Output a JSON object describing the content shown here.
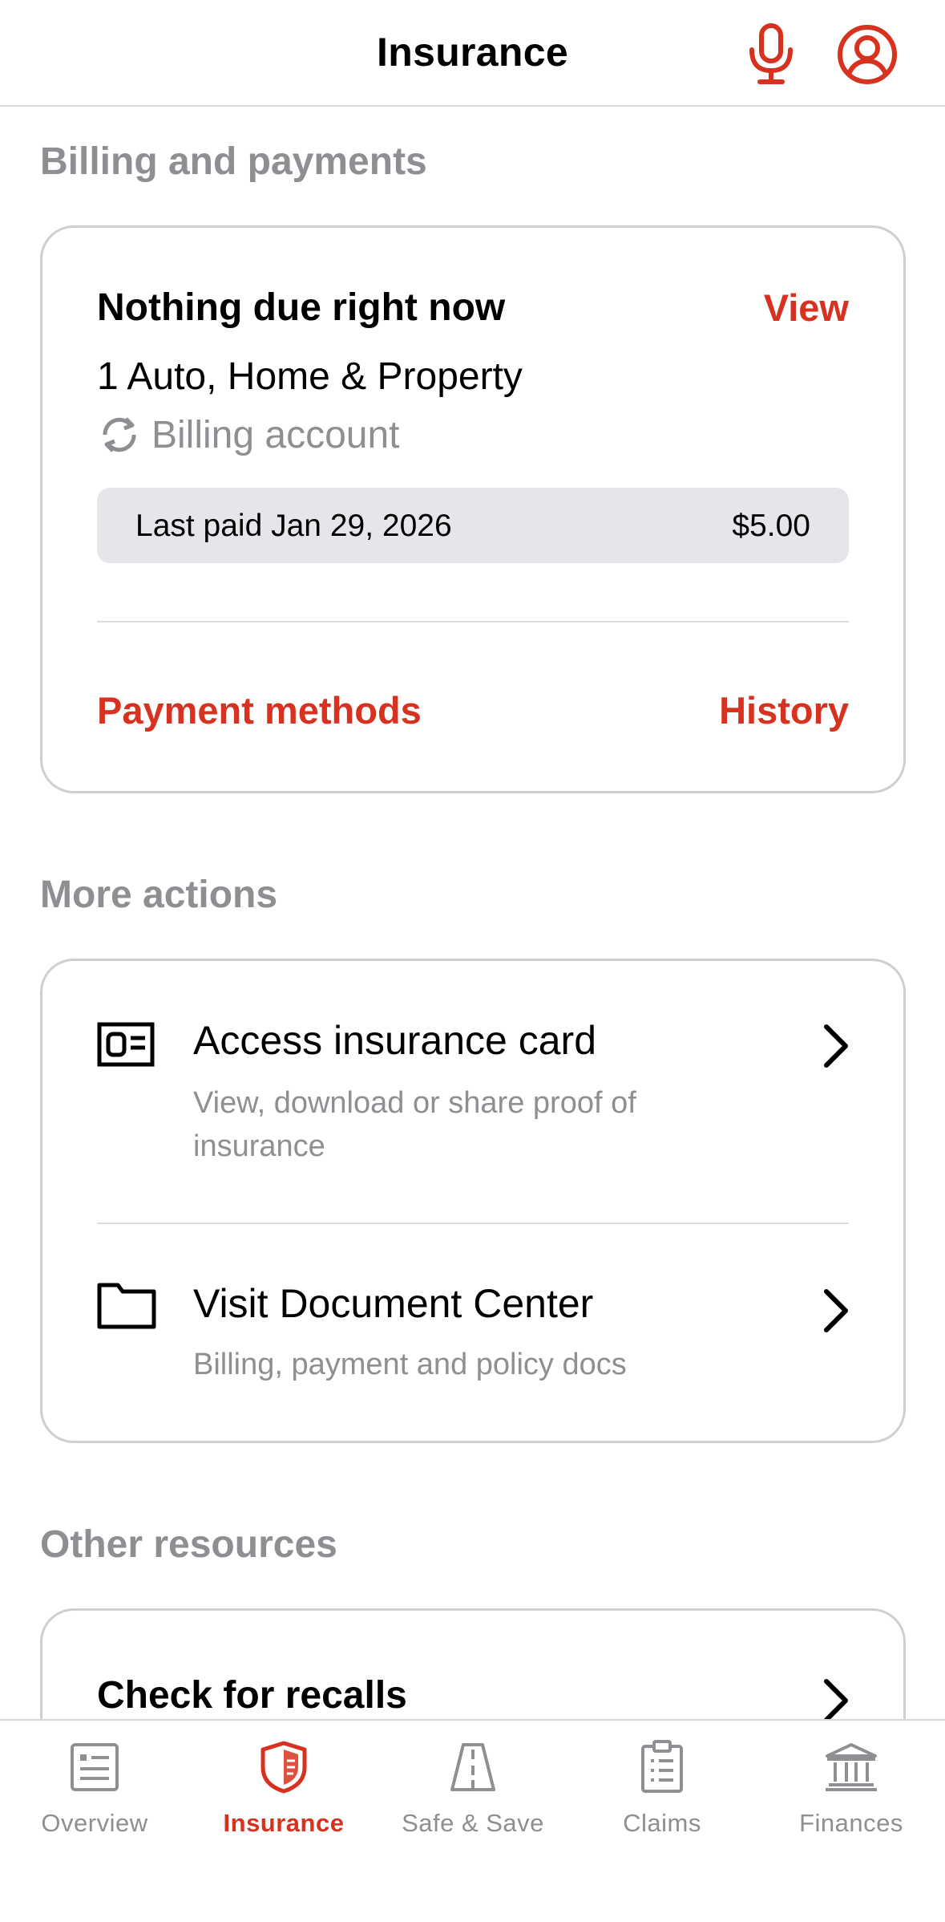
{
  "header": {
    "title": "Insurance"
  },
  "billing": {
    "section_title": "Billing and payments",
    "status": "Nothing due right now",
    "view_label": "View",
    "policies": "1 Auto, Home & Property",
    "account_label": "Billing account",
    "last_paid": "Last paid Jan 29, 2026",
    "amount": "$5.00",
    "payment_methods_label": "Payment methods",
    "history_label": "History"
  },
  "more_actions": {
    "section_title": "More actions",
    "items": [
      {
        "title": "Access insurance card",
        "desc": "View, download or share proof of insurance",
        "icon": "id-card-icon"
      },
      {
        "title": "Visit Document Center",
        "desc": "Billing, payment and policy docs",
        "icon": "folder-icon"
      }
    ]
  },
  "other_resources": {
    "section_title": "Other resources",
    "items": [
      {
        "title": "Check for recalls"
      }
    ]
  },
  "tabbar": {
    "tabs": [
      {
        "label": "Overview",
        "icon": "overview-icon"
      },
      {
        "label": "Insurance",
        "icon": "shield-icon",
        "active": true
      },
      {
        "label": "Safe & Save",
        "icon": "road-icon"
      },
      {
        "label": "Claims",
        "icon": "clipboard-icon"
      },
      {
        "label": "Finances",
        "icon": "bank-icon"
      }
    ]
  },
  "colors": {
    "accent": "#d6321f",
    "muted": "#8e8e93",
    "divider": "#dcdce0",
    "paid_bg": "#e6e6ea"
  }
}
